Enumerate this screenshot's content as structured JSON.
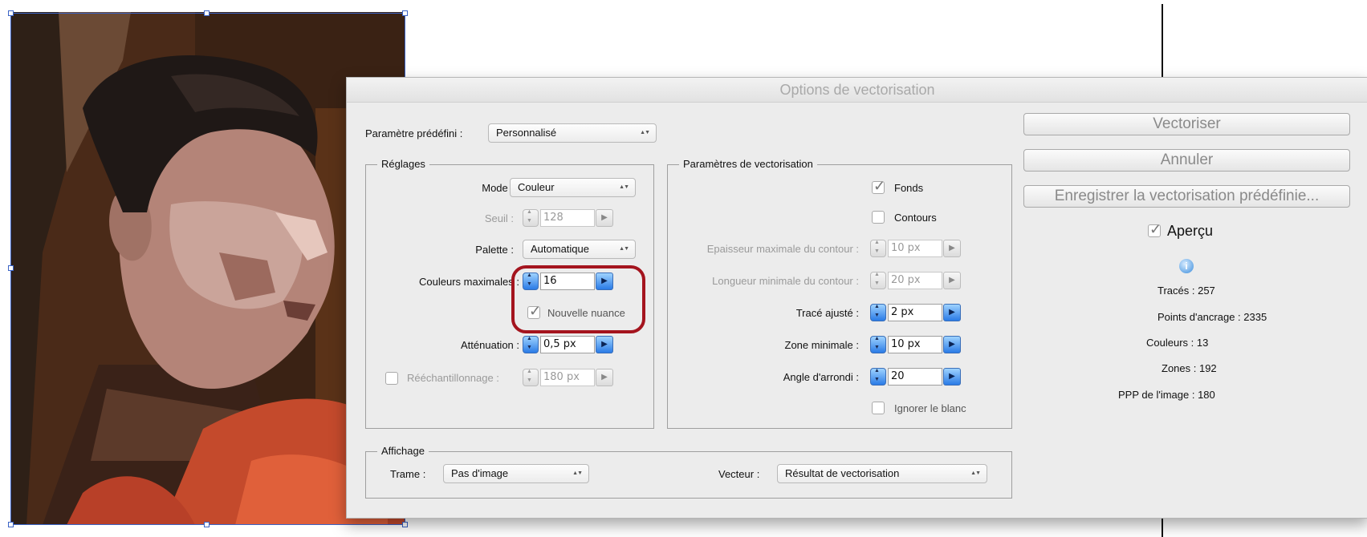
{
  "dialog": {
    "title": "Options de vectorisation"
  },
  "preset": {
    "label": "Paramètre prédéfini :",
    "value": "Personnalisé"
  },
  "settings": {
    "title": "Réglages",
    "mode": {
      "label": "Mode :",
      "value": "Couleur"
    },
    "threshold": {
      "label": "Seuil :",
      "value": "128"
    },
    "palette": {
      "label": "Palette :",
      "value": "Automatique"
    },
    "max_colors": {
      "label": "Couleurs maximales :",
      "value": "16"
    },
    "new_swatch": {
      "label": "Nouvelle nuance",
      "checked": true
    },
    "blur": {
      "label": "Atténuation :",
      "value": "0,5 px"
    },
    "resample": {
      "label": "Rééchantillonnage :",
      "value": "180 px",
      "checked": false
    }
  },
  "trace_params": {
    "title": "Paramètres de vectorisation",
    "fills": {
      "label": "Fonds",
      "checked": true
    },
    "strokes": {
      "label": "Contours",
      "checked": false
    },
    "max_stroke_weight": {
      "label": "Epaisseur maximale du contour :",
      "value": "10 px"
    },
    "min_stroke_length": {
      "label": "Longueur minimale du contour :",
      "value": "20 px"
    },
    "path_fitting": {
      "label": "Tracé ajusté :",
      "value": "2 px"
    },
    "min_area": {
      "label": "Zone minimale :",
      "value": "10 px"
    },
    "corner_angle": {
      "label": "Angle d'arrondi :",
      "value": "20"
    },
    "ignore_white": {
      "label": "Ignorer le blanc",
      "checked": false
    }
  },
  "view": {
    "title": "Affichage",
    "raster": {
      "label": "Trame :",
      "value": "Pas d'image"
    },
    "vector": {
      "label": "Vecteur :",
      "value": "Résultat de vectorisation"
    }
  },
  "buttons": {
    "trace": "Vectoriser",
    "cancel": "Annuler",
    "save_preset": "Enregistrer la vectorisation prédéfinie..."
  },
  "preview": {
    "label": "Aperçu",
    "checked": true
  },
  "info_icon": "info-icon",
  "stats": {
    "paths": "Tracés : 257",
    "anchors": "Points d'ancrage : 2335",
    "colors": "Couleurs : 13",
    "areas": "Zones : 192",
    "ppi": "PPP de l'image : 180"
  },
  "colors": {
    "highlight": "#a4141e",
    "accent": "#2a7be6",
    "selection": "#3a63c6"
  }
}
